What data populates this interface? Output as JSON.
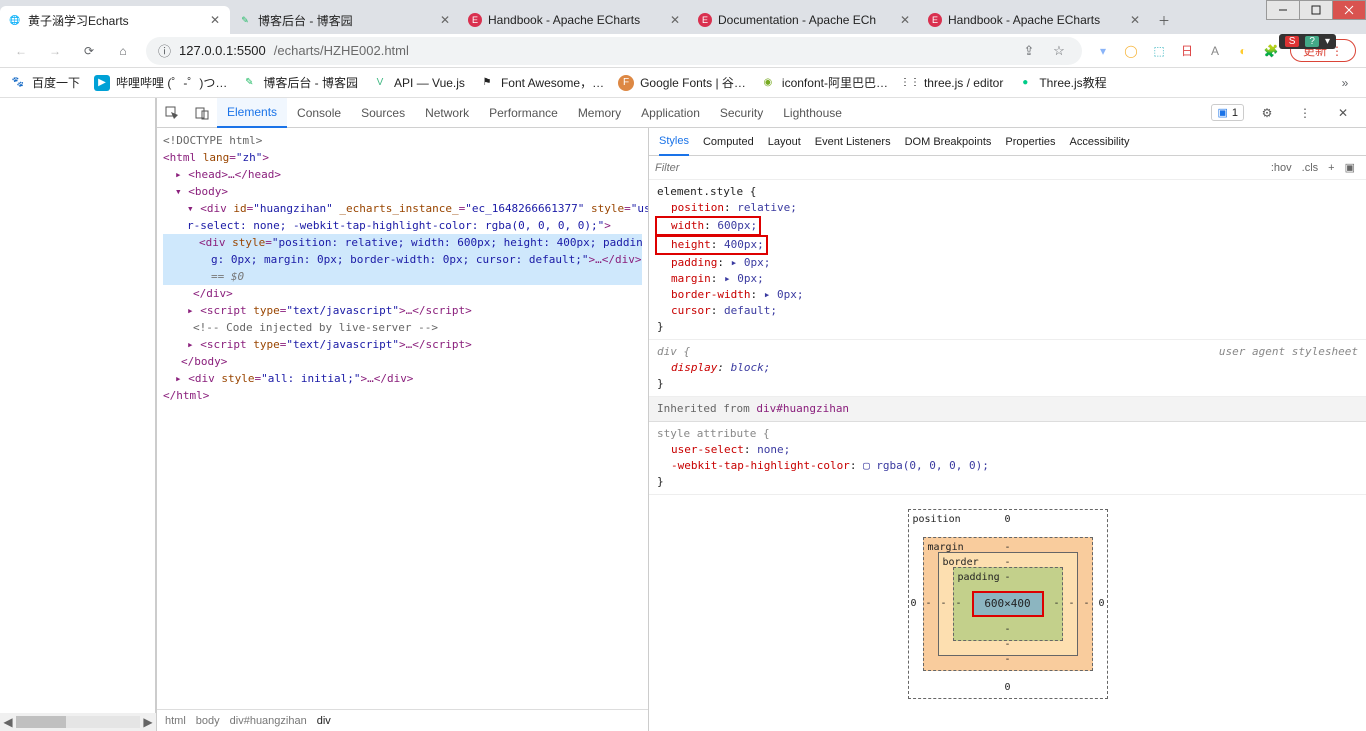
{
  "window_controls": {
    "minimize": "minimize",
    "maximize": "maximize",
    "close": "close"
  },
  "tabs": [
    {
      "title": "黄子涵学习Echarts",
      "favicon": "🌐",
      "active": true
    },
    {
      "title": "博客后台 - 博客园",
      "favicon": "✎",
      "active": false
    },
    {
      "title": "Handbook - Apache ECharts",
      "favicon": "◯",
      "color": "#d9304f",
      "active": false
    },
    {
      "title": "Documentation - Apache ECharts",
      "favicon": "◯",
      "color": "#d9304f",
      "active": false,
      "truncated": "Documentation - Apache ECh"
    },
    {
      "title": "Handbook - Apache ECharts",
      "favicon": "◯",
      "color": "#d9304f",
      "active": false
    }
  ],
  "addressbar": {
    "info_label": "ⓘ",
    "host": "127.0.0.1",
    "port": ":5500",
    "path": "/echarts/HZHE002.html",
    "update_label": "更新",
    "ime_text": "S"
  },
  "bookmarks": [
    {
      "label": "百度一下",
      "icon": "爪",
      "color": "#2b5bd2"
    },
    {
      "label": "哔哩哔哩 (゜-゜)つ…",
      "icon": "▶",
      "color": "#00a1d6"
    },
    {
      "label": "博客后台 - 博客园",
      "icon": "✎",
      "color": "#2b6"
    },
    {
      "label": "API — Vue.js",
      "icon": "V",
      "color": "#41b883"
    },
    {
      "label": "Font Awesome，…",
      "icon": "⚑",
      "color": "#222"
    },
    {
      "label": "Google Fonts | 谷…",
      "icon": "F",
      "color": "#d84"
    },
    {
      "label": "iconfont-阿里巴巴…",
      "icon": "◉",
      "color": "#7a2"
    },
    {
      "label": "three.js / editor",
      "icon": "⋮⋮",
      "color": "#000"
    },
    {
      "label": "Three.js教程",
      "icon": "●",
      "color": "#0c8"
    }
  ],
  "devtools": {
    "top_tabs": [
      "Elements",
      "Console",
      "Sources",
      "Network",
      "Performance",
      "Memory",
      "Application",
      "Security",
      "Lighthouse"
    ],
    "active_top": "Elements",
    "issues_count": "1",
    "dom": {
      "doctype": "<!DOCTYPE html>",
      "html_open": "<html lang=\"zh\">",
      "head": "<head>…</head>",
      "body_open": "<body>",
      "div_open_1": "<div id=\"huangzihan\" _echarts_instance_=\"ec_1648266661377\" style=\"use",
      "div_open_2": "r-select: none; -webkit-tap-highlight-color: rgba(0, 0, 0, 0);\">",
      "sel_1": "<div style=\"position: relative; width: 600px; height: 400px; paddin",
      "sel_2": "g: 0px; margin: 0px; border-width: 0px; cursor: default;\">…</div>",
      "sel_info": "== $0",
      "div_close": "</div>",
      "script1": "<script type=\"text/javascript\">…</scr",
      "comment": "<!-- Code injected by live-server -->",
      "script2": "<script type=\"text/javascript\">…</scr",
      "body_close": "</body>",
      "last_div": "<div style=\"all: initial;\">…</div>",
      "html_close": "</html>"
    },
    "breadcrumb": [
      "html",
      "body",
      "div#huangzihan",
      "div"
    ],
    "styles_tabs": [
      "Styles",
      "Computed",
      "Layout",
      "Event Listeners",
      "DOM Breakpoints",
      "Properties",
      "Accessibility"
    ],
    "active_styles_tab": "Styles",
    "filter_placeholder": "Filter",
    "filter_actions": [
      ":hov",
      ".cls",
      "+"
    ],
    "rules": {
      "element_style_selector": "element.style {",
      "props": [
        {
          "n": "position",
          "v": "relative;"
        },
        {
          "n": "width",
          "v": "600px;",
          "hl": true
        },
        {
          "n": "height",
          "v": "400px;",
          "hl": true
        },
        {
          "n": "padding",
          "v": "▸ 0px;"
        },
        {
          "n": "margin",
          "v": "▸ 0px;"
        },
        {
          "n": "border-width",
          "v": "▸ 0px;"
        },
        {
          "n": "cursor",
          "v": "default;"
        }
      ],
      "close": "}",
      "ua_selector": "div {",
      "ua_note": "user agent stylesheet",
      "ua_prop_n": "display",
      "ua_prop_v": "block;",
      "inherited": "Inherited from",
      "inherited_sel": "div#huangzihan",
      "styleattr": "style attribute {",
      "inh_props": [
        {
          "n": "user-select",
          "v": "none;"
        },
        {
          "n": "-webkit-tap-highlight-color",
          "v": "▢ rgba(0, 0, 0, 0);"
        }
      ]
    },
    "boxmodel": {
      "position_label": "position",
      "position_vals": {
        "t": "-",
        "r": "0",
        "b": "0",
        "l": "0",
        "top_num": "0"
      },
      "margin_label": "margin",
      "margin_val": "-",
      "border_label": "border",
      "border_val": "-",
      "padding_label": "padding",
      "padding_val": "-",
      "content": "600×400"
    }
  }
}
